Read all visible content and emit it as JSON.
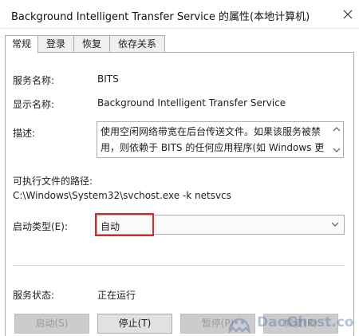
{
  "window": {
    "title": "Background Intelligent Transfer Service 的属性(本地计算机)",
    "close_glyph": "×"
  },
  "tabs": [
    {
      "label": "常规",
      "active": true
    },
    {
      "label": "登录",
      "active": false
    },
    {
      "label": "恢复",
      "active": false
    },
    {
      "label": "依存关系",
      "active": false
    }
  ],
  "general": {
    "service_name_label": "服务名称:",
    "service_name": "BITS",
    "display_name_label": "显示名称:",
    "display_name": "Background Intelligent Transfer Service",
    "description_label": "描述:",
    "description": "使用空闲网络带宽在后台传送文件。如果该服务被禁用，则依赖于 BITS 的任何应用程序(如 Windows 更新",
    "exe_path_label": "可执行文件的路径:",
    "exe_path": "C:\\Windows\\System32\\svchost.exe -k netsvcs",
    "startup_type_label": "启动类型(E):",
    "startup_type": "自动",
    "status_label": "服务状态:",
    "status": "正在运行"
  },
  "buttons": {
    "start": "启动(S)",
    "stop": "停止(T)",
    "pause": "暂停(P)",
    "resume": "恢复(R)"
  },
  "watermark": {
    "text": "DaoGhost.co"
  },
  "colors": {
    "highlight": "#e02424",
    "tab_border": "#adadad"
  }
}
